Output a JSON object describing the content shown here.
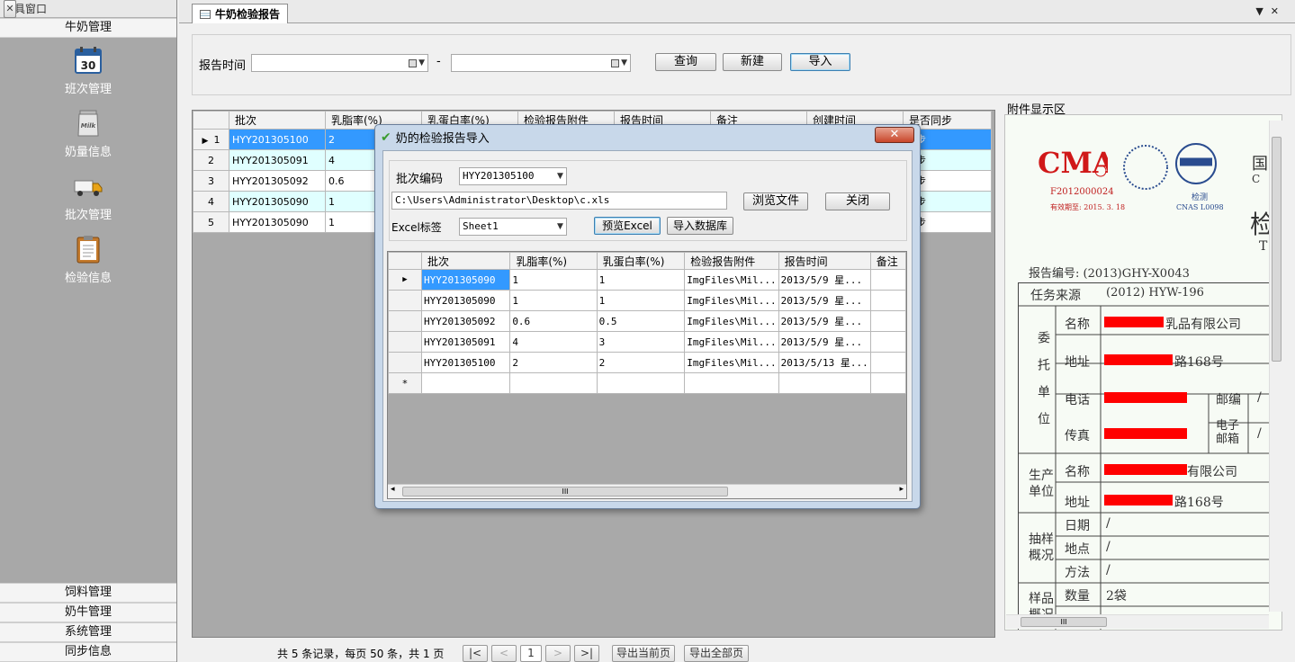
{
  "toolwin": {
    "title": "工具窗口",
    "pin": "ꟸ",
    "close": "✕",
    "group_top": "牛奶管理",
    "items": [
      {
        "label": "班次管理",
        "icon": "calendar-icon",
        "num": "30"
      },
      {
        "label": "奶量信息",
        "icon": "milk-can-icon",
        "num": "Milk"
      },
      {
        "label": "批次管理",
        "icon": "truck-icon"
      },
      {
        "label": "检验信息",
        "icon": "clipboard-icon"
      }
    ],
    "groups_bottom": [
      "饲料管理",
      "奶牛管理",
      "系统管理",
      "同步信息"
    ]
  },
  "tab": {
    "title": "牛奶检验报告",
    "ctrl_dropdown": "▼",
    "ctrl_close": "✕"
  },
  "search": {
    "report_time_label": "报告时间",
    "date_sep": "-",
    "from_value": "",
    "to_value": "",
    "query_btn": "查询",
    "new_btn": "新建",
    "import_btn": "导入"
  },
  "grid": {
    "columns": [
      "批次",
      "乳脂率(%)",
      "乳蛋白率(%)",
      "检验报告附件",
      "报告时间",
      "备注",
      "创建时间",
      "是否同步"
    ],
    "rows": [
      {
        "no": "1",
        "batch": "HYY201305100",
        "fat": "2",
        "sync": "同步"
      },
      {
        "no": "2",
        "batch": "HYY201305091",
        "fat": "4",
        "sync": "同步"
      },
      {
        "no": "3",
        "batch": "HYY201305092",
        "fat": "0.6",
        "sync": "同步"
      },
      {
        "no": "4",
        "batch": "HYY201305090",
        "fat": "1",
        "sync": "同步"
      },
      {
        "no": "5",
        "batch": "HYY201305090",
        "fat": "1",
        "sync": "同步"
      }
    ],
    "row_pointer": "▶"
  },
  "pager": {
    "summary": "共 5 条记录，每页 50 条，共 1 页",
    "first": "|<",
    "prev": "<",
    "page": "1",
    "next": ">",
    "last": ">|",
    "export_current": "导出当前页",
    "export_all": "导出全部页"
  },
  "attachment": {
    "label": "附件显示区",
    "cert_code": "F2012000024",
    "cert_valid": "有效期至: 2015. 3. 18",
    "cnas_text": "检测",
    "cnas_code": "CNAS L0098",
    "report_no": "报告编号:   (2013)GHY-X0043",
    "task_source_label": "任务来源",
    "task_source_value": "(2012) HYW-196",
    "rows": [
      {
        "label": "名称",
        "value": "乳品有限公司"
      },
      {
        "label": "地址",
        "value": "路168号"
      },
      {
        "label": "电话",
        "value": ""
      },
      {
        "label": "传真",
        "value": ""
      },
      {
        "label": "名称",
        "value": "有限公司"
      },
      {
        "label": "地址",
        "value": "路168号"
      }
    ],
    "entrust": "委托单位",
    "producer": "生产单位",
    "postcode": "邮编",
    "email": "电子邮箱",
    "slash": "/",
    "sampling": "抽样概况",
    "sampling_rows": [
      {
        "label": "日期",
        "value": "/"
      },
      {
        "label": "地点",
        "value": "/"
      },
      {
        "label": "方法",
        "value": "/"
      }
    ],
    "sample": "样品概况",
    "qty_label": "数量",
    "qty_value": "2袋",
    "side_chars": [
      "国",
      "C",
      "检",
      "T"
    ]
  },
  "dialog": {
    "title": "奶的检验报告导入",
    "close": "✕",
    "batch_label": "批次编码",
    "batch_value": "HYY201305100",
    "path": "C:\\Users\\Administrator\\Desktop\\c.xls",
    "browse_btn": "浏览文件",
    "close_btn": "关闭",
    "excel_label": "Excel标签",
    "sheet_value": "Sheet1",
    "preview_btn": "预览Excel",
    "import_db_btn": "导入数据库",
    "columns": [
      "批次",
      "乳脂率(%)",
      "乳蛋白率(%)",
      "检验报告附件",
      "报告时间",
      "备注"
    ],
    "rows": [
      {
        "batch": "HYY201305090",
        "fat": "1",
        "protein": "1",
        "file": "ImgFiles\\Mil...",
        "time": "2013/5/9 星..."
      },
      {
        "batch": "HYY201305090",
        "fat": "1",
        "protein": "1",
        "file": "ImgFiles\\Mil...",
        "time": "2013/5/9 星..."
      },
      {
        "batch": "HYY201305092",
        "fat": "0.6",
        "protein": "0.5",
        "file": "ImgFiles\\Mil...",
        "time": "2013/5/9 星..."
      },
      {
        "batch": "HYY201305091",
        "fat": "4",
        "protein": "3",
        "file": "ImgFiles\\Mil...",
        "time": "2013/5/9 星..."
      },
      {
        "batch": "HYY201305100",
        "fat": "2",
        "protein": "2",
        "file": "ImgFiles\\Mil...",
        "time": "2013/5/13 星..."
      }
    ],
    "new_row_marker": "*",
    "row_pointer": "▶",
    "scroll_grip": "III"
  }
}
